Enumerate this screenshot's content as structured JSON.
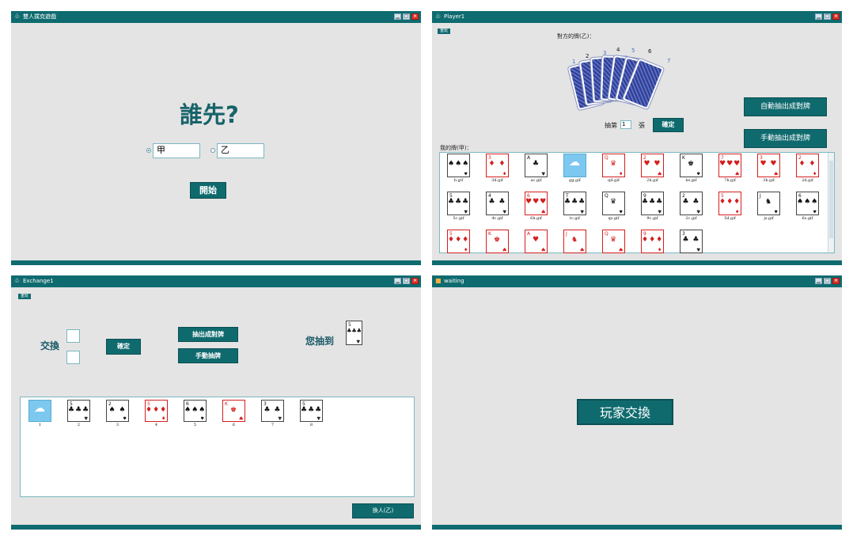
{
  "panel1": {
    "title": "雙人撲克遊戲",
    "heading": "誰先?",
    "option_a_value": "甲",
    "option_b_value": "乙",
    "start_label": "開始"
  },
  "panel2": {
    "title": "Player1",
    "tag_label": "重玩",
    "opponent_label": "對方的牌(乙)：",
    "back_card_numbers": [
      "1",
      "2",
      "3",
      "4",
      "5",
      "6",
      "7"
    ],
    "auto_draw_label": "自動抽出成對牌",
    "manual_draw_label": "手動抽出成對牌",
    "draw_prefix": "抽第",
    "draw_value": "1",
    "draw_suffix": "張",
    "confirm_label": "確定",
    "my_cards_label": "我的牌(甲)：",
    "cards": [
      {
        "name": "b.gif",
        "rank": "",
        "suit": "♠",
        "mid": "♠♠♠",
        "color": "black"
      },
      {
        "name": "3d.gif",
        "rank": "3",
        "suit": "♦",
        "mid": "♦ ♦",
        "color": "red"
      },
      {
        "name": "ac.gif",
        "rank": "A",
        "suit": "♣",
        "mid": "♣",
        "color": "black"
      },
      {
        "name": "gg.gif",
        "rank": "",
        "suit": "",
        "mid": "",
        "color": "joker"
      },
      {
        "name": "qd.gif",
        "rank": "Q",
        "suit": "♦",
        "mid": "♛",
        "color": "red"
      },
      {
        "name": "2h.gif",
        "rank": "2",
        "suit": "♥",
        "mid": "♥ ♥",
        "color": "red"
      },
      {
        "name": "ks.gif",
        "rank": "K",
        "suit": "♠",
        "mid": "♚",
        "color": "black"
      },
      {
        "name": "7h.gif",
        "rank": "7",
        "suit": "♥",
        "mid": "♥♥♥",
        "color": "red"
      },
      {
        "name": "3h.gif",
        "rank": "3",
        "suit": "♥",
        "mid": "♥ ♥",
        "color": "red"
      },
      {
        "name": "2d.gif",
        "rank": "2",
        "suit": "♦",
        "mid": "♦ ♦",
        "color": "red"
      },
      {
        "name": "5c.gif",
        "rank": "5",
        "suit": "♣",
        "mid": "♣♣♣",
        "color": "black"
      },
      {
        "name": "4c.gif",
        "rank": "4",
        "suit": "♣",
        "mid": "♣ ♣",
        "color": "black"
      },
      {
        "name": "6h.gif",
        "rank": "6",
        "suit": "♥",
        "mid": "♥♥♥",
        "color": "red"
      },
      {
        "name": "tc.gif",
        "rank": "T",
        "suit": "♣",
        "mid": "♣♣♣",
        "color": "black"
      },
      {
        "name": "qs.gif",
        "rank": "Q",
        "suit": "♠",
        "mid": "♛",
        "color": "black"
      },
      {
        "name": "9c.gif",
        "rank": "9",
        "suit": "♣",
        "mid": "♣♣♣",
        "color": "black"
      },
      {
        "name": "2c.gif",
        "rank": "2",
        "suit": "♣",
        "mid": "♣ ♣",
        "color": "black"
      },
      {
        "name": "5d.gif",
        "rank": "5",
        "suit": "♦",
        "mid": "♦♦♦",
        "color": "red"
      },
      {
        "name": "js.gif",
        "rank": "J",
        "suit": "♠",
        "mid": "♞",
        "color": "black"
      },
      {
        "name": "6s.gif",
        "rank": "6",
        "suit": "♠",
        "mid": "♠♠♠",
        "color": "black"
      },
      {
        "name": "",
        "rank": "5",
        "suit": "♦",
        "mid": "♦♦♦",
        "color": "red"
      },
      {
        "name": "",
        "rank": "K",
        "suit": "♥",
        "mid": "♚",
        "color": "red"
      },
      {
        "name": "",
        "rank": "A",
        "suit": "♥",
        "mid": "♥",
        "color": "red"
      },
      {
        "name": "",
        "rank": "J",
        "suit": "♥",
        "mid": "♞",
        "color": "red"
      },
      {
        "name": "",
        "rank": "Q",
        "suit": "♥",
        "mid": "♛",
        "color": "red"
      },
      {
        "name": "",
        "rank": "9",
        "suit": "♦",
        "mid": "♦♦♦",
        "color": "red"
      },
      {
        "name": "",
        "rank": "3",
        "suit": "♣",
        "mid": "♣ ♣",
        "color": "black"
      }
    ]
  },
  "panel3": {
    "title": "Exchange1",
    "tag_label": "重玩",
    "exchange_label": "交換",
    "confirm_label": "確定",
    "draw_pairs_label": "抽出成對牌",
    "manual_draw_label": "手動抽牌",
    "you_drew_label": "您抽到",
    "drawn_card": {
      "rank": "5",
      "suit": "♣",
      "mid": "♣♣♣",
      "color": "black"
    },
    "cards": [
      {
        "name": "1",
        "rank": "",
        "suit": "",
        "mid": "",
        "color": "joker"
      },
      {
        "name": "2",
        "rank": "5",
        "suit": "♣",
        "mid": "♣♣♣",
        "color": "black"
      },
      {
        "name": "3",
        "rank": "2",
        "suit": "♠",
        "mid": "♠ ♠",
        "color": "black"
      },
      {
        "name": "4",
        "rank": "5",
        "suit": "♦",
        "mid": "♦♦♦",
        "color": "red"
      },
      {
        "name": "5",
        "rank": "6",
        "suit": "♠",
        "mid": "♠♠♠",
        "color": "black"
      },
      {
        "name": "6",
        "rank": "K",
        "suit": "♥",
        "mid": "♚",
        "color": "red"
      },
      {
        "name": "7",
        "rank": "3",
        "suit": "♣",
        "mid": "♣ ♣",
        "color": "black"
      },
      {
        "name": "8",
        "rank": "5",
        "suit": "♣",
        "mid": "♣♣♣",
        "color": "black"
      }
    ],
    "switch_label": "換人(乙)"
  },
  "panel4": {
    "title": "waiting",
    "center_label": "玩家交換"
  },
  "window_controls": {
    "minimize": "▁",
    "maximize": "□",
    "close": "✕"
  },
  "colors": {
    "accent": "#0f6a6e",
    "background": "#e4e4e4",
    "close": "#d9342b"
  }
}
